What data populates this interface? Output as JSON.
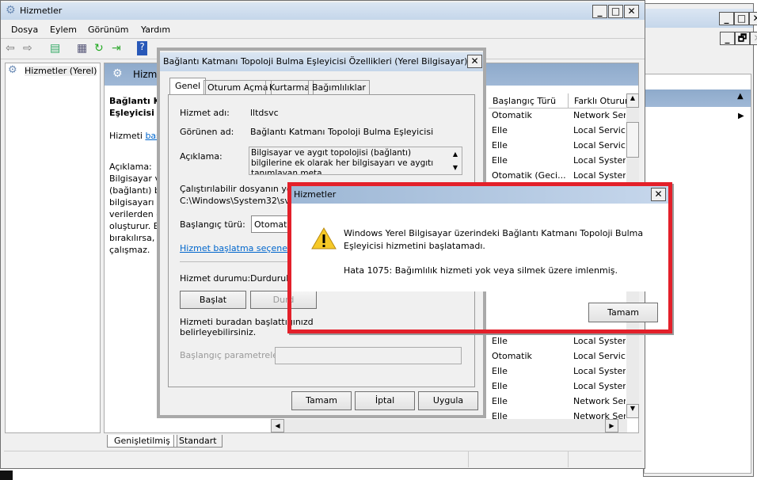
{
  "main_window": {
    "title": "Hizmetler",
    "menu": [
      "Dosya",
      "Eylem",
      "Görünüm",
      "Yardım"
    ],
    "tree_item": "Hizmetler (Yerel)",
    "pane_header": "Hizmetler (Yerel)",
    "detail": {
      "service_title_line1": "Bağlantı Ka",
      "service_title_line2": "Eşleyicisi",
      "start_prefix": "Hizmeti ",
      "start_link": "baş",
      "desc_label": "Açıklama:",
      "desc_lines": [
        "Bilgisayar v",
        "(bağlantı) b",
        "bilgisayarı v",
        "verilerden c",
        "oluşturur.  E",
        "bırakılırsa, A",
        "çalışmaz."
      ]
    },
    "columns": [
      "Başlangıç Türü",
      "Farklı Oturum"
    ],
    "rows_top": [
      [
        "Otomatik",
        "Network Ser"
      ],
      [
        "Elle",
        "Local Service"
      ],
      [
        "Elle",
        "Local Service"
      ],
      [
        "Elle",
        "Local System"
      ],
      [
        "Otomatik (Geci...",
        "Local System"
      ]
    ],
    "rows_bottom": [
      [
        "Elle",
        "Local System"
      ],
      [
        "Otomatik",
        "Local Service"
      ],
      [
        "Elle",
        "Local System"
      ],
      [
        "Elle",
        "Local System"
      ],
      [
        "Elle",
        "Network Ser"
      ],
      [
        "Elle",
        "Network Ser"
      ]
    ],
    "bottom_tabs": [
      "Genişletilmiş",
      "Standart"
    ]
  },
  "properties_dialog": {
    "title": "Bağlantı Katmanı Topoloji Bulma Eşleyicisi Özellikleri (Yerel Bilgisayar)",
    "tabs": [
      "Genel",
      "Oturum Açma",
      "Kurtarma",
      "Bağımlılıklar"
    ],
    "service_name_label": "Hizmet adı:",
    "service_name": "lltdsvc",
    "display_name_label": "Görünen ad:",
    "display_name": "Bağlantı Katmanı Topoloji Bulma Eşleyicisi",
    "description_label": "Açıklama:",
    "description": "Bilgisayar ve aygıt topolojisi (bağlantı) bilgilerine ek olarak her bilgisayarı ve aygıtı tanımlayan meta",
    "path_label": "Çalıştırılabilir dosyanın yolu:",
    "path": "C:\\Windows\\System32\\svch",
    "startup_type_label": "Başlangıç türü:",
    "startup_type": "Otomatik",
    "startup_options_link": "Hizmet başlatma seçeneklerini",
    "status_label": "Hizmet durumu:",
    "status": "Durduruld",
    "start_button": "Başlat",
    "stop_button": "Durd",
    "hint": "Hizmeti buradan başlattığınızd",
    "hint2": "belirleyebilirsiniz.",
    "params_label": "Başlangıç parametreleri:",
    "params_value": "",
    "ok": "Tamam",
    "cancel": "İptal",
    "apply": "Uygula"
  },
  "error_dialog": {
    "title": "Hizmetler",
    "message_line1": "Windows Yerel Bilgisayar üzerindeki Bağlantı Katmanı Topoloji Bulma",
    "message_line2": "Eşleyicisi hizmetini başlatamadı.",
    "error": "Hata 1075: Bağımlılık hizmeti yok veya silmek üzere imlenmiş.",
    "ok": "Tamam",
    "highlight_color": "#e3202a"
  }
}
